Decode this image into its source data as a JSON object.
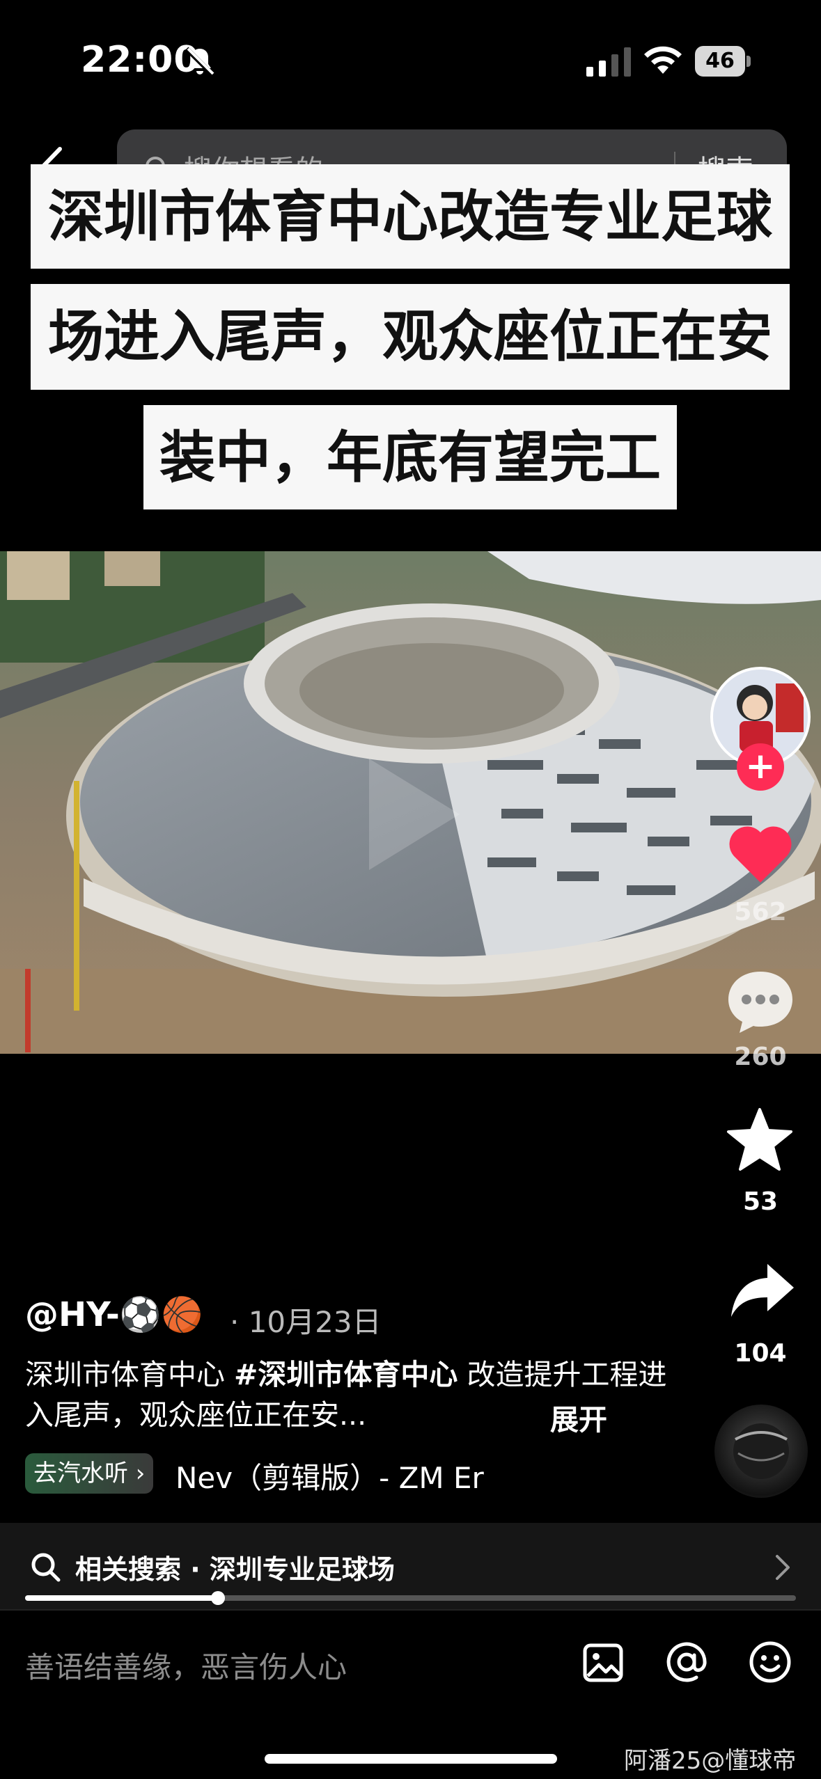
{
  "status_bar": {
    "time": "22:00",
    "battery": "46"
  },
  "search": {
    "placeholder": "搜你想看的",
    "button": "搜索"
  },
  "headline": {
    "line1": "深圳市体育中心改造专业足球",
    "line2": "场进入尾声，观众座位正在安",
    "line3": "装中，年底有望完工"
  },
  "actions": {
    "likes": "562",
    "comments": "260",
    "favorites": "53",
    "shares": "104",
    "follow": "+"
  },
  "post": {
    "author": "@HY-⚽🏀",
    "date": "· 10月23日",
    "desc_prefix": "深圳市体育中心 ",
    "hashtag": "#深圳市体育中心",
    "desc_suffix": " 改造提升工程进入尾声，观众座位正在安...",
    "expand": "展开",
    "music_chip": "去汽水听 ›",
    "music_title": "Nev（剪辑版）- ZM    Er"
  },
  "related": {
    "text": "相关搜索 · 深圳专业足球场"
  },
  "playback": {
    "progress": 0.25
  },
  "comment_bar": {
    "placeholder": "善语结善缘，恶言伤人心"
  },
  "watermark": "阿潘25@懂球帝",
  "colors": {
    "accent": "#fe2c55",
    "like": "#fe2c55",
    "background": "#000000"
  }
}
